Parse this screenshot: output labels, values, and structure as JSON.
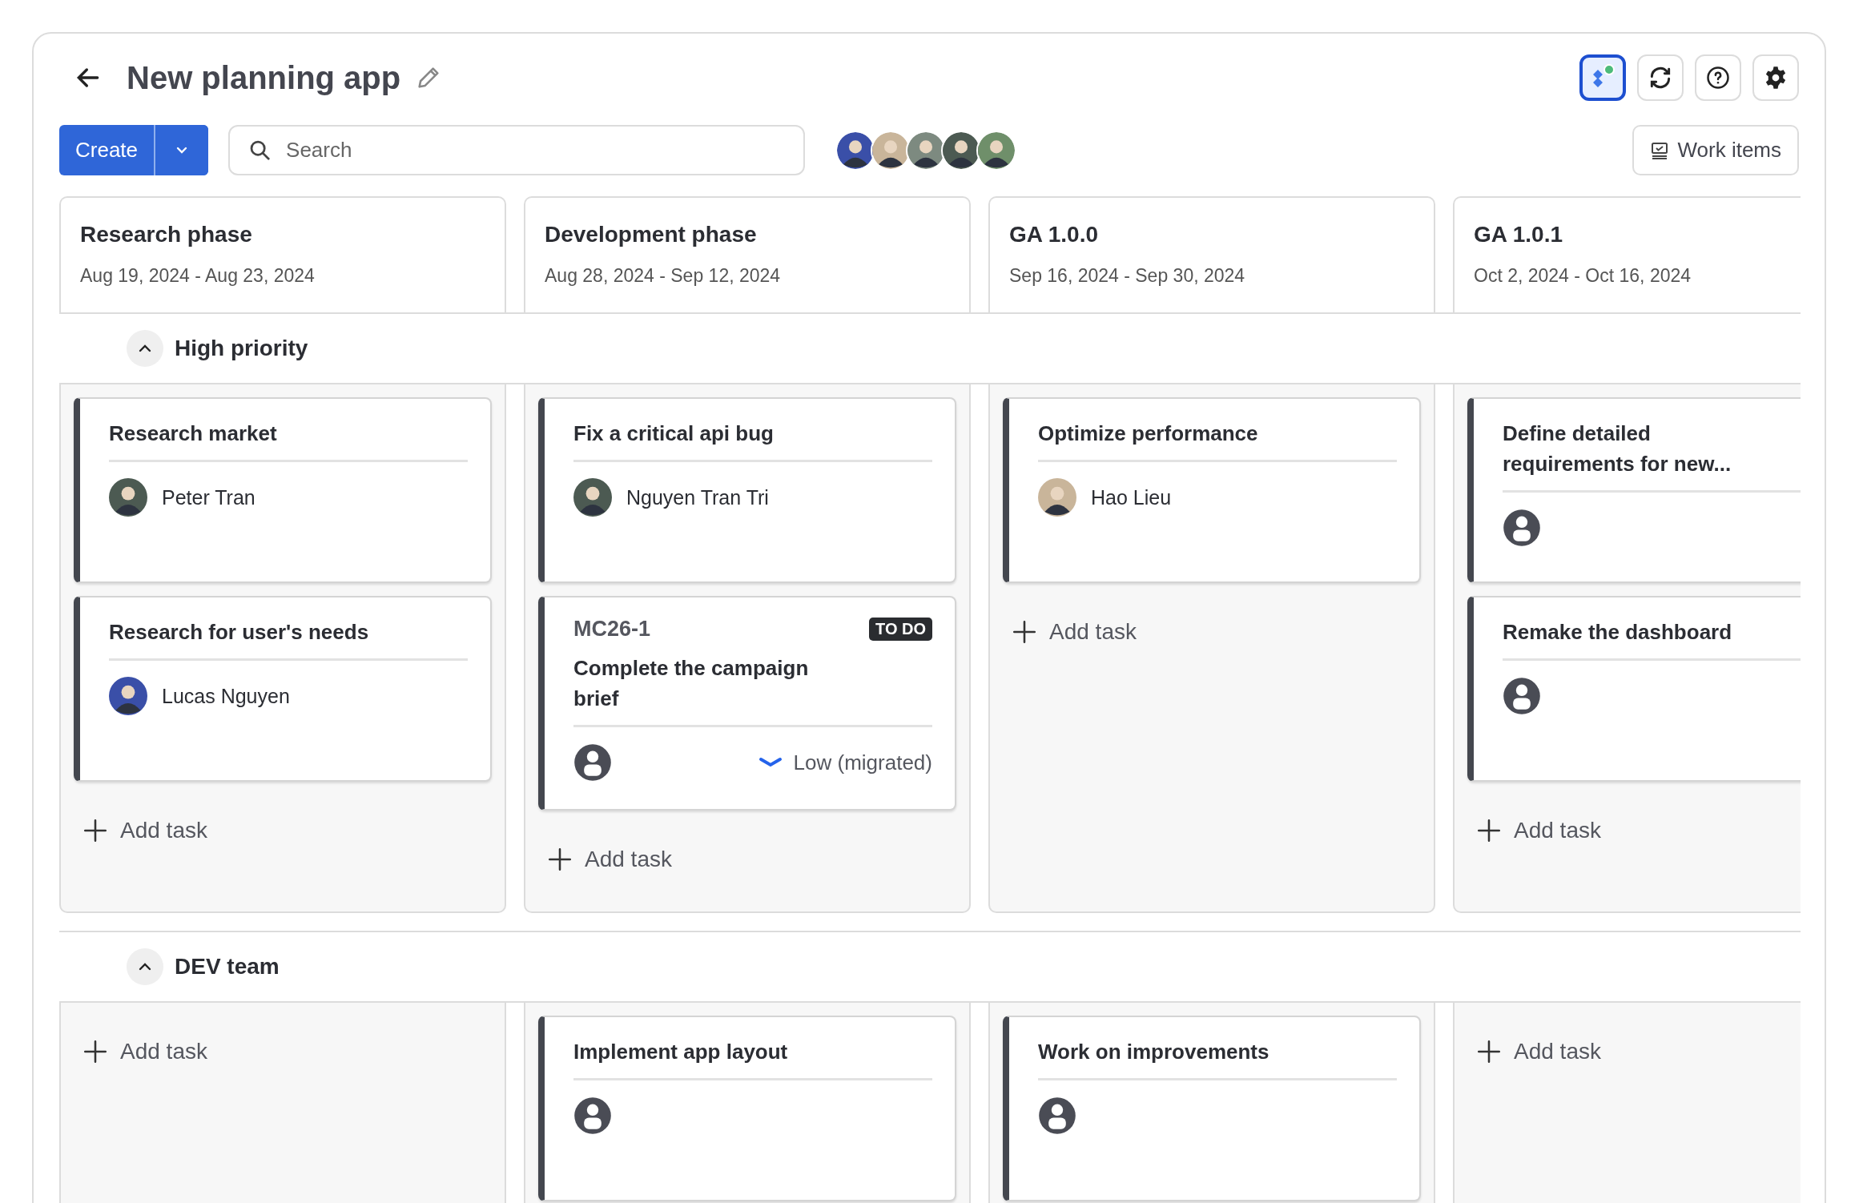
{
  "header": {
    "title": "New planning app",
    "actions": [
      {
        "kind": "planner",
        "selected": true
      },
      {
        "kind": "sync",
        "selected": false
      },
      {
        "kind": "help",
        "selected": false
      },
      {
        "kind": "settings",
        "selected": false
      }
    ]
  },
  "toolbar": {
    "create": "Create",
    "search": {
      "placeholder": "Search"
    },
    "team": [
      {
        "kind": "photo"
      },
      {
        "kind": "photo"
      },
      {
        "kind": "photo"
      },
      {
        "kind": "photo"
      },
      {
        "kind": "photo"
      }
    ],
    "work_items": "Work items"
  },
  "columns": [
    {
      "title": "Research phase",
      "dates": "Aug 19, 2024 - Aug 23, 2024"
    },
    {
      "title": "Development phase",
      "dates": "Aug 28, 2024 - Sep 12, 2024"
    },
    {
      "title": "GA 1.0.0",
      "dates": "Sep 16, 2024 - Sep 30, 2024"
    },
    {
      "title": "GA 1.0.1",
      "dates": "Oct 2, 2024 - Oct 16, 2024"
    }
  ],
  "lanes": [
    {
      "title": "High priority",
      "expanded": true,
      "cells": [
        {
          "cards": [
            {
              "title": "Research market",
              "assignee": {
                "kind": "photo",
                "name": "Peter Tran"
              }
            },
            {
              "title": "Research for user's needs",
              "assignee": {
                "kind": "photo",
                "name": "Lucas Nguyen"
              }
            }
          ],
          "add_label": "Add task"
        },
        {
          "cards": [
            {
              "title": "Fix a critical api bug",
              "assignee": {
                "kind": "photo",
                "name": "Nguyen Tran Tri"
              }
            },
            {
              "key": "MC26-1",
              "status": "TO DO",
              "title": "Complete the campaign brief",
              "assignee": {
                "kind": "unassigned"
              },
              "priority": "Low (migrated)"
            }
          ],
          "add_label": "Add task"
        },
        {
          "cards": [
            {
              "title": "Optimize performance",
              "assignee": {
                "kind": "photo",
                "name": "Hao Lieu"
              }
            }
          ],
          "add_label": "Add task"
        },
        {
          "cards": [
            {
              "title": "Define detailed requirements for new...",
              "assignee": {
                "kind": "unassigned"
              }
            },
            {
              "title": "Remake the dashboard",
              "assignee": {
                "kind": "unassigned"
              }
            }
          ],
          "add_label": "Add task"
        }
      ]
    },
    {
      "title": "DEV team",
      "expanded": true,
      "cells": [
        {
          "add_label": "Add task"
        },
        {
          "cards": [
            {
              "title": "Implement app layout",
              "assignee": {
                "kind": "unassigned"
              }
            }
          ]
        },
        {
          "cards": [
            {
              "title": "Work on improvements",
              "assignee": {
                "kind": "unassigned"
              }
            }
          ]
        },
        {
          "add_label": "Add task"
        }
      ]
    }
  ]
}
